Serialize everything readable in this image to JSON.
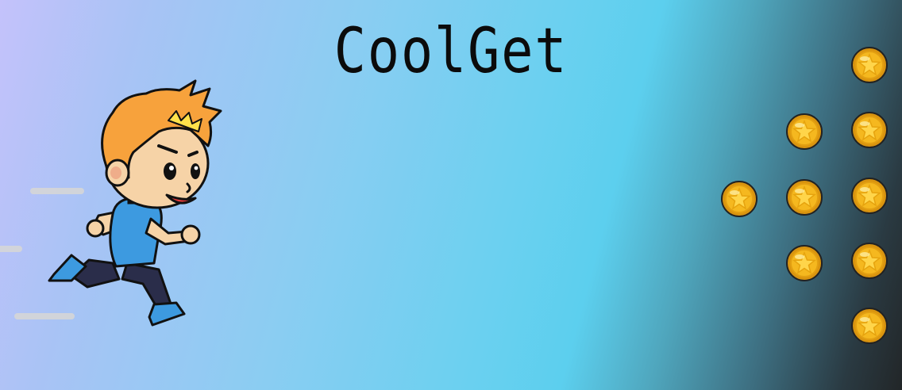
{
  "game": {
    "title": "CoolGet"
  },
  "player": {
    "icon": "running-boy-icon",
    "hair_color": "#f7a23c",
    "shirt_color": "#3d9ae0",
    "pants_color": "#2a2d4a"
  },
  "coins": {
    "icon": "gold-star-coin-icon",
    "count": 9,
    "color": "#f5b81f"
  },
  "colors": {
    "sky_left": "#c4c2fb",
    "sky_mid": "#5ccfee",
    "sky_right": "#222628"
  }
}
